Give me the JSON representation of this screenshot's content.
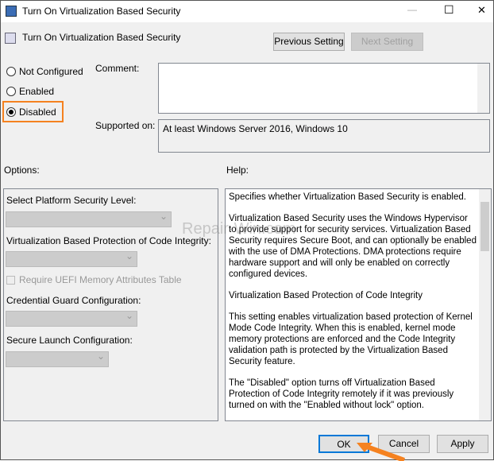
{
  "window": {
    "title": "Turn On Virtualization Based Security",
    "minimize": "—",
    "maximize": "☐",
    "close": "✕"
  },
  "header": {
    "policy_title": "Turn On Virtualization Based Security",
    "prev_label": "Previous Setting",
    "next_label": "Next Setting"
  },
  "state": {
    "options": [
      {
        "label": "Not Configured",
        "selected": false
      },
      {
        "label": "Enabled",
        "selected": false
      },
      {
        "label": "Disabled",
        "selected": true
      }
    ]
  },
  "comment": {
    "label": "Comment:",
    "value": ""
  },
  "supported": {
    "label": "Supported on:",
    "value": "At least Windows Server 2016, Windows 10"
  },
  "options_label": "Options:",
  "help_label": "Help:",
  "options_panel": {
    "platform_label": "Select Platform Security Level:",
    "code_integrity_label": "Virtualization Based Protection of Code Integrity:",
    "uefi_label": "Require UEFI Memory Attributes Table",
    "credential_label": "Credential Guard Configuration:",
    "secure_launch_label": "Secure Launch Configuration:"
  },
  "help_text": [
    "Specifies whether Virtualization Based Security is enabled.",
    "Virtualization Based Security uses the Windows Hypervisor to provide support for security services. Virtualization Based Security requires Secure Boot, and can optionally be enabled with the use of DMA Protections. DMA protections require hardware support and will only be enabled on correctly configured devices.",
    "Virtualization Based Protection of Code Integrity",
    "This setting enables virtualization based protection of Kernel Mode Code Integrity. When this is enabled, kernel mode memory protections are enforced and the Code Integrity validation path is protected by the Virtualization Based Security feature.",
    "The \"Disabled\" option turns off Virtualization Based Protection of Code Integrity remotely if it was previously turned on with the \"Enabled without lock\" option."
  ],
  "footer": {
    "ok": "OK",
    "cancel": "Cancel",
    "apply": "Apply"
  },
  "watermark": "Repair-Win.com",
  "colors": {
    "highlight": "#f58220",
    "focus": "#0078d7"
  }
}
